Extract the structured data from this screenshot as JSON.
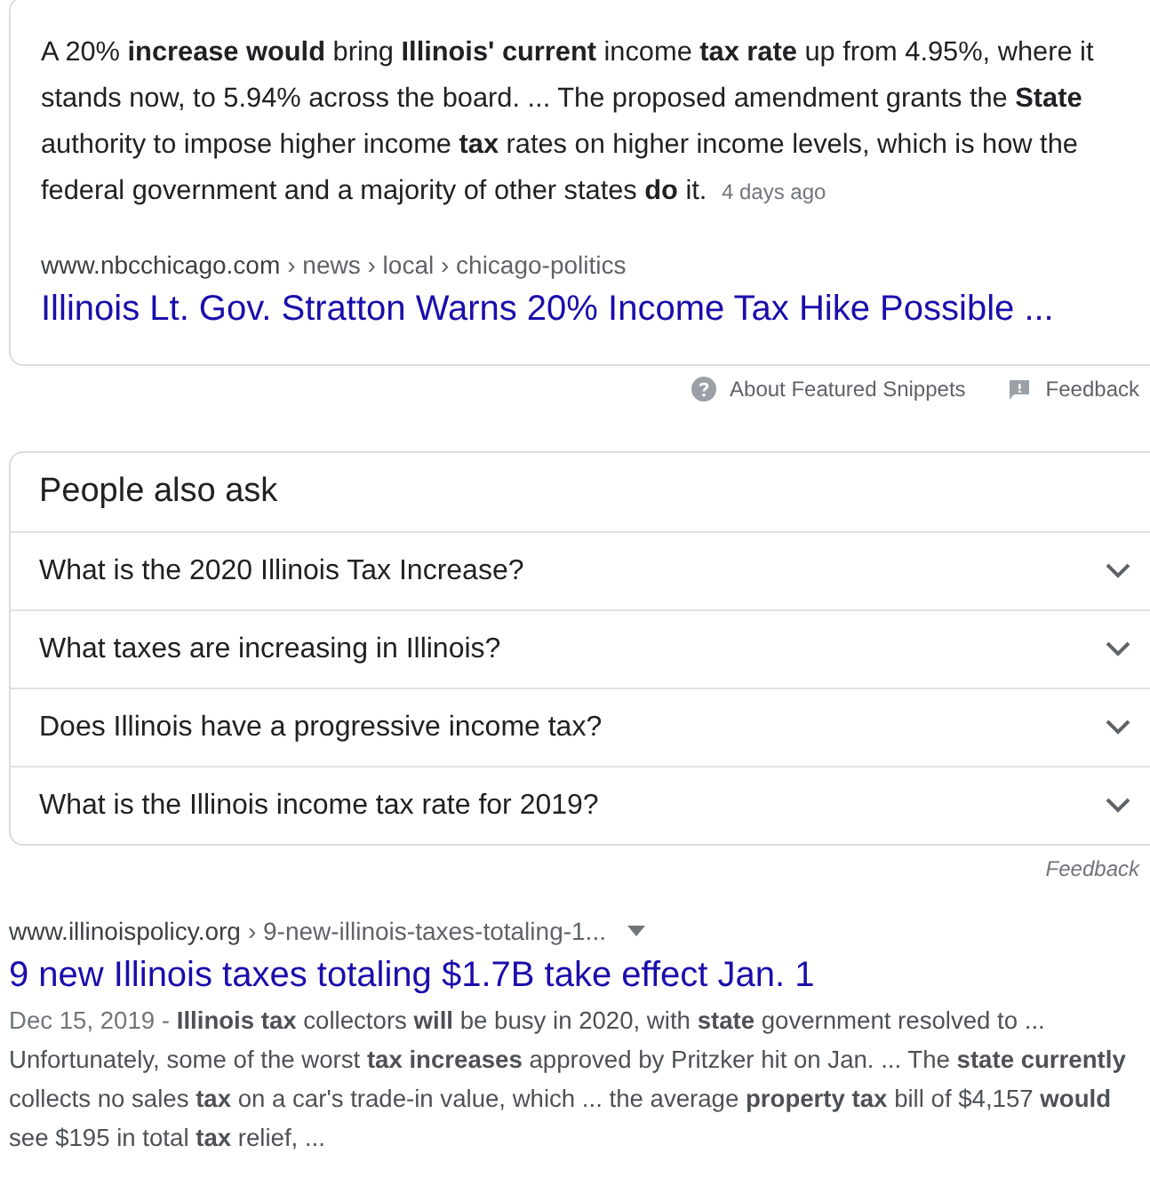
{
  "featured_snippet": {
    "text": "A 20% **increase would** bring **Illinois' current** income **tax rate** up from 4.95%, where it stands now, to 5.94% across the board. ... The proposed amendment grants the **State** authority to impose higher income **tax** rates on higher income levels, which is how the federal government and a majority of other states **do** it.",
    "age": "4 days ago",
    "site": "www.nbcchicago.com",
    "path": "› news › local › chicago-politics",
    "title": "Illinois Lt. Gov. Stratton Warns 20% Income Tax Hike Possible ..."
  },
  "snippet_footer": {
    "about": "About Featured Snippets",
    "feedback": "Feedback"
  },
  "people_also_ask": {
    "heading": "People also ask",
    "questions": [
      {
        "text": "What is the 2020 Illinois Tax Increase?",
        "expanded": false
      },
      {
        "text": "What taxes are increasing in Illinois?",
        "expanded": false
      },
      {
        "text": "Does Illinois have a progressive income tax?",
        "expanded": false
      },
      {
        "text": "What is the Illinois income tax rate for 2019?",
        "expanded": false
      }
    ],
    "feedback": "Feedback"
  },
  "result": {
    "site": "www.illinoispolicy.org",
    "path": "› 9-new-illinois-taxes-totaling-1...",
    "title": "9 new Illinois taxes totaling $1.7B take effect Jan. 1",
    "date": "Dec 15, 2019 -",
    "snippet": "**Illinois tax** collectors **will** be busy in 2020, with **state** government resolved to ... Unfortunately, some of the worst **tax increases** approved by Pritzker hit on Jan. ... The **state currently** collects no sales **tax** on a car's trade-in value, which ... the average **property tax** bill of $4,157 **would** see $195 in total **tax** relief, ..."
  }
}
